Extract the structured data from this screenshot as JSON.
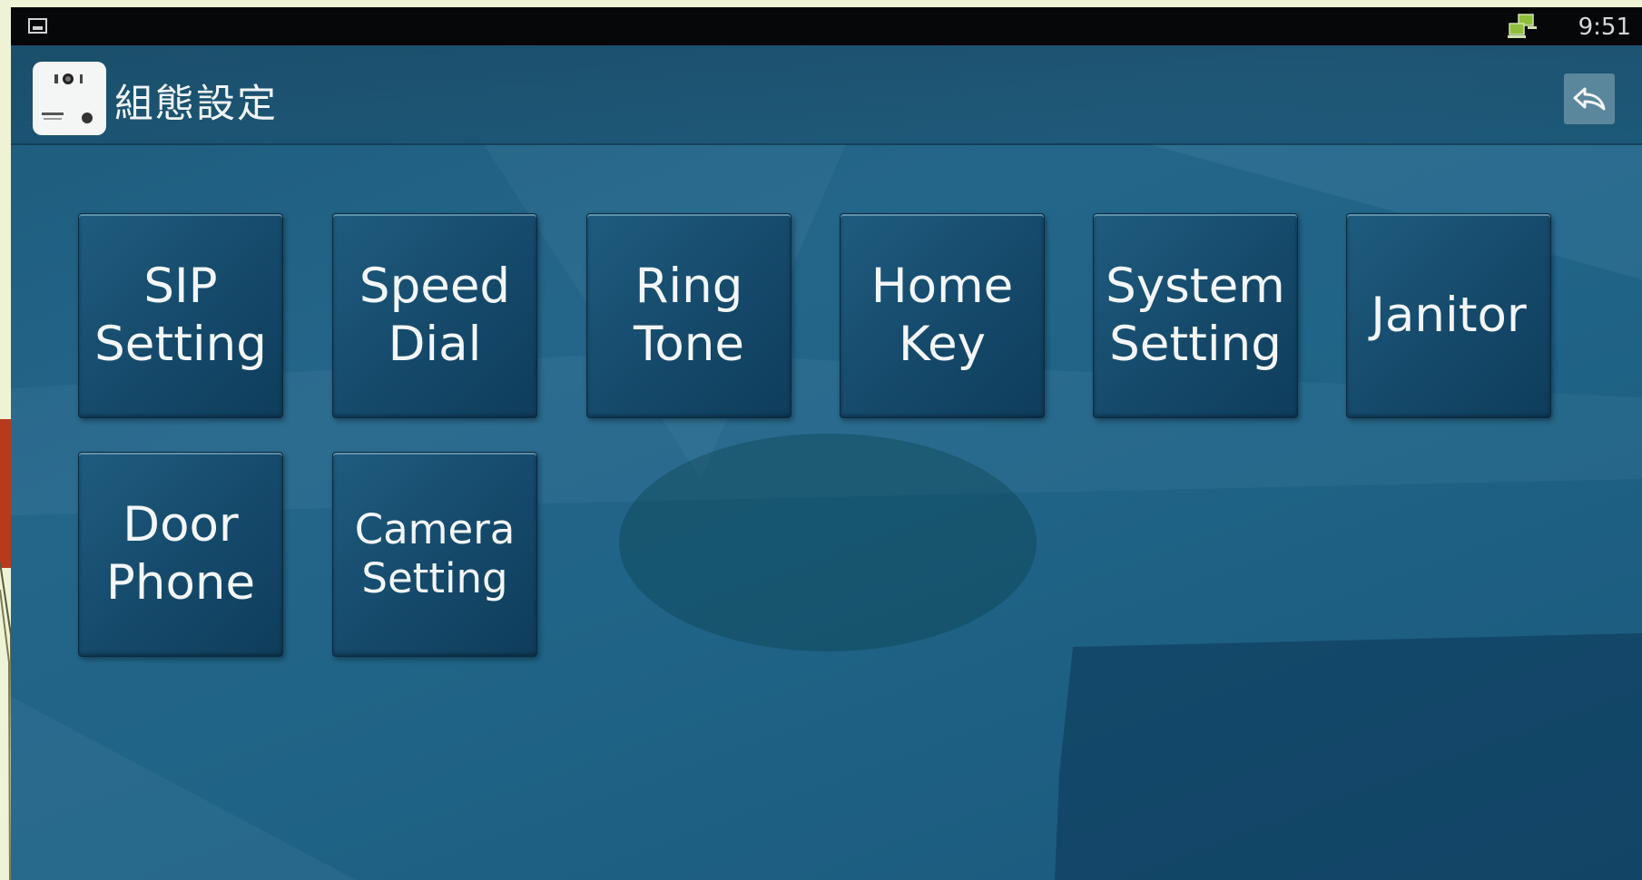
{
  "status_bar": {
    "time": "9:51",
    "left_icon": "image-notification-icon",
    "network_icon": "network-status-icon"
  },
  "action_bar": {
    "title": "組態設定",
    "app_icon": "v-bell-app-icon",
    "back_icon": "back-arrow-icon"
  },
  "menu": {
    "tiles": [
      {
        "label": "SIP\nSetting"
      },
      {
        "label": "Speed\nDial"
      },
      {
        "label": "Ring\nTone"
      },
      {
        "label": "Home\nKey"
      },
      {
        "label": "System\nSetting"
      },
      {
        "label": "Janitor"
      },
      {
        "label": "Door\nPhone"
      },
      {
        "label": "Camera\nSetting"
      }
    ]
  },
  "colors": {
    "background": "#1f6386",
    "status_bar": "#050708",
    "tile": "#15496a",
    "text": "#f3f6f8"
  }
}
